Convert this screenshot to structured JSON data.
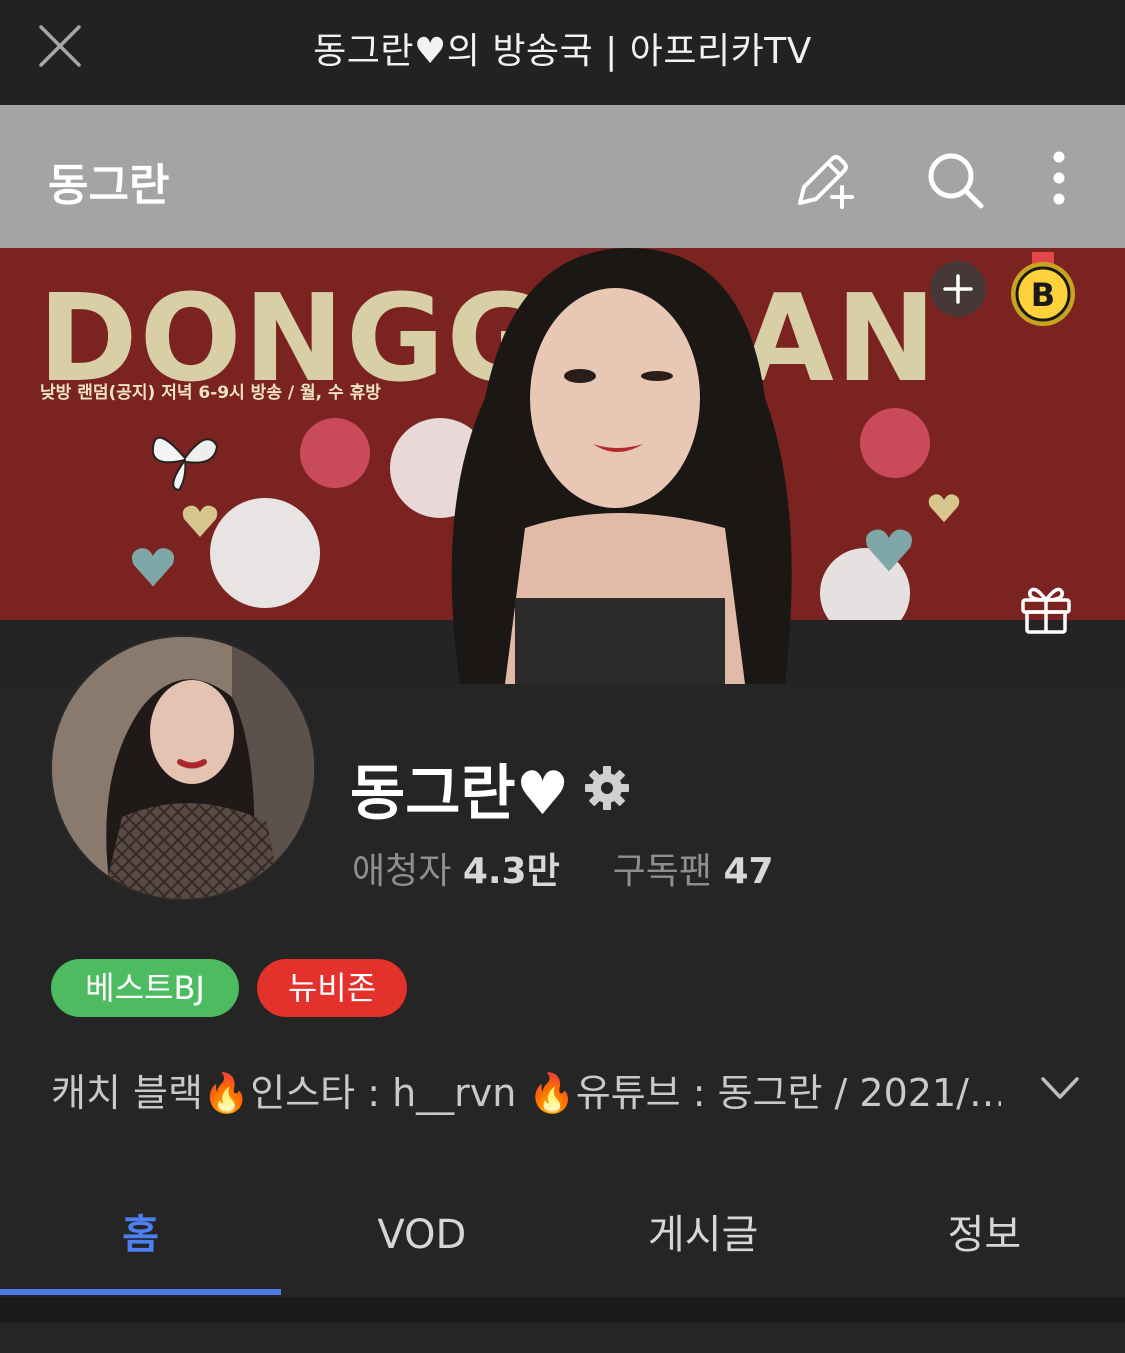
{
  "window": {
    "title": "동그란♥의 방송국 | 아프리카TV",
    "close_icon": "close-icon"
  },
  "header": {
    "channel_name": "동그란",
    "icons": [
      "write-post-icon",
      "search-icon",
      "more-vertical-icon"
    ]
  },
  "banner": {
    "headline": "DONGGURAN",
    "schedule": "낮방 랜덤(공지) 저녁 6-9시 방송 / 월, 수 휴방",
    "badge_letter": "B",
    "icons": [
      "add-icon",
      "best-bj-medal-icon",
      "gift-icon"
    ]
  },
  "profile": {
    "name": "동그란♥",
    "viewers_label": "애청자",
    "viewers_value": "4.3만",
    "subscribers_label": "구독팬",
    "subscribers_value": "47",
    "tags": [
      "베스트BJ",
      "뉴비존"
    ],
    "description": "캐치 블랙🔥인스타 : h__rvn 🔥유튜브 : 동그란 / 2021/…"
  },
  "tabs": [
    {
      "label": "홈",
      "active": true
    },
    {
      "label": "VOD",
      "active": false
    },
    {
      "label": "게시글",
      "active": false
    },
    {
      "label": "정보",
      "active": false
    }
  ],
  "colors": {
    "accent": "#4c7ff0",
    "best_tag": "#4dbb5f",
    "newbie_tag": "#e5312c",
    "banner_bg": "#7a2320"
  }
}
